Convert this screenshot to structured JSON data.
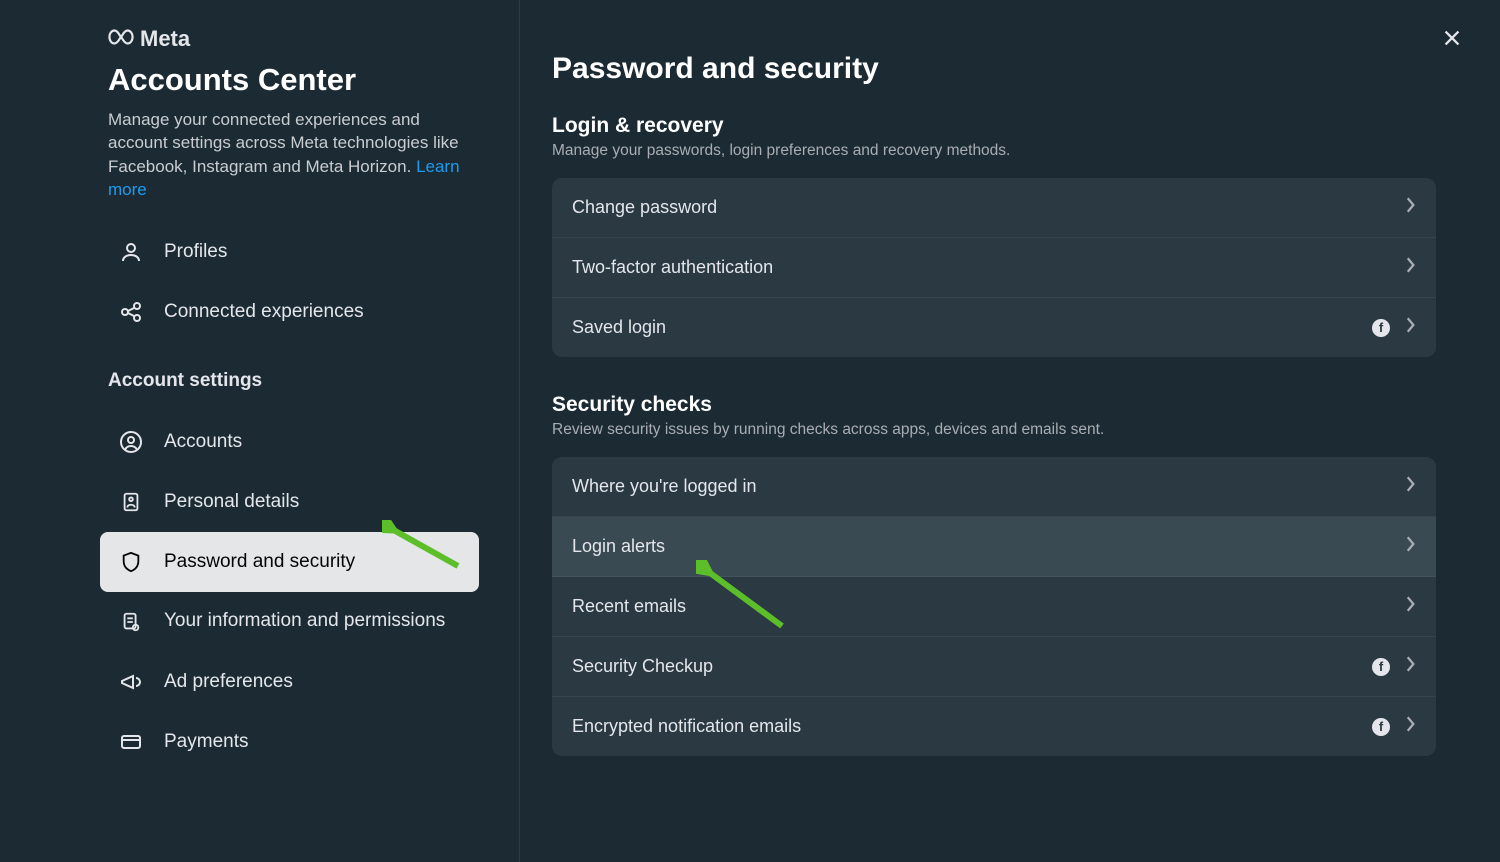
{
  "brand": {
    "name": "Meta"
  },
  "sidebar": {
    "title": "Accounts Center",
    "description": "Manage your connected experiences and account settings across Meta technologies like Facebook, Instagram and Meta Horizon.",
    "learn_more": "Learn more",
    "primary_nav": [
      {
        "id": "profiles",
        "label": "Profiles",
        "icon": "person"
      },
      {
        "id": "connected",
        "label": "Connected experiences",
        "icon": "share"
      }
    ],
    "settings_heading": "Account settings",
    "settings_nav": [
      {
        "id": "accounts",
        "label": "Accounts",
        "icon": "user-circle"
      },
      {
        "id": "personal",
        "label": "Personal details",
        "icon": "id-card"
      },
      {
        "id": "security",
        "label": "Password and security",
        "icon": "shield",
        "active": true
      },
      {
        "id": "info-perms",
        "label": "Your information and permissions",
        "label2": "",
        "icon": "doc-lock"
      },
      {
        "id": "ads",
        "label": "Ad preferences",
        "icon": "megaphone"
      },
      {
        "id": "payments",
        "label": "Payments",
        "icon": "card"
      }
    ]
  },
  "main": {
    "title": "Password and security",
    "groups": [
      {
        "title": "Login & recovery",
        "description": "Manage your passwords, login preferences and recovery methods.",
        "items": [
          {
            "id": "change-password",
            "label": "Change password"
          },
          {
            "id": "two-factor",
            "label": "Two-factor authentication"
          },
          {
            "id": "saved-login",
            "label": "Saved login",
            "fb": true
          }
        ]
      },
      {
        "title": "Security checks",
        "description": "Review security issues by running checks across apps, devices and emails sent.",
        "items": [
          {
            "id": "where-logged-in",
            "label": "Where you're logged in"
          },
          {
            "id": "login-alerts",
            "label": "Login alerts",
            "hover": true
          },
          {
            "id": "recent-emails",
            "label": "Recent emails"
          },
          {
            "id": "security-checkup",
            "label": "Security Checkup",
            "fb": true
          },
          {
            "id": "encrypted-emails",
            "label": "Encrypted notification emails",
            "fb": true
          }
        ]
      }
    ]
  }
}
